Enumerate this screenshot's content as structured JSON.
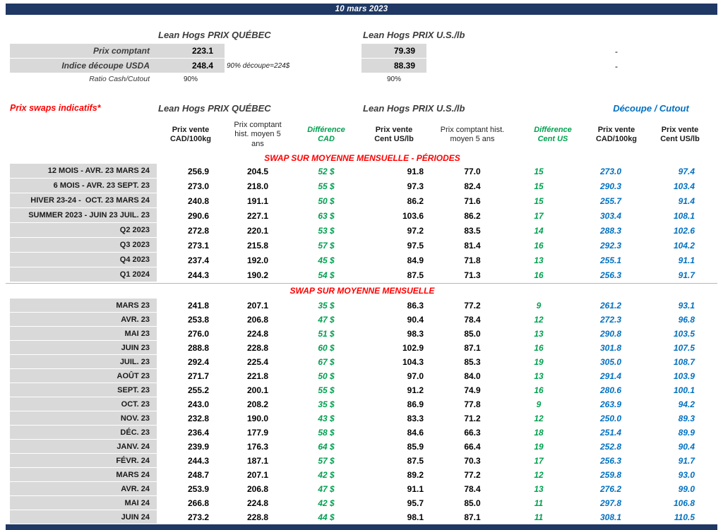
{
  "page": {
    "date": "10 mars 2023"
  },
  "colors": {
    "navy": "#1F3864",
    "red": "#FF0000",
    "green": "#00A050",
    "blue": "#0070C0",
    "gray": "#D9D9D9"
  },
  "spot": {
    "qc_header": "Lean Hogs PRIX QUÉBEC",
    "us_header": "Lean Hogs PRIX U.S./lb",
    "rows": [
      {
        "label": "Prix comptant",
        "qc": "223.1",
        "note": "",
        "us": "79.39",
        "right": "-"
      },
      {
        "label": "Indice découpe USDA",
        "qc": "248.4",
        "note": "90% découpe=224$",
        "us": "88.39",
        "right": "-"
      }
    ],
    "ratio": {
      "label": "Ratio Cash/Cutout",
      "qc": "90%",
      "us": "90%"
    }
  },
  "swaps": {
    "title": "Prix swaps indicatifs*",
    "qc_header": "Lean Hogs PRIX QUÉBEC",
    "us_header": "Lean Hogs PRIX U.S./lb",
    "cutout_header": "Découpe / Cutout",
    "col_headers": [
      "Prix vente\nCAD/100kg",
      "Prix comptant\nhist. moyen 5\nans",
      "Différence\nCAD",
      "Prix vente\nCent US/lb",
      "Prix comptant hist.\nmoyen 5 ans",
      "Différence\nCent US",
      "Prix vente\nCAD/100kg",
      "Prix vente\nCent US/lb"
    ],
    "periods": {
      "title": "SWAP SUR MOYENNE MENSUELLE - PÉRIODES",
      "rows": [
        {
          "label": "12 MOIS - AVR. 23 MARS 24",
          "values": [
            "256.9",
            "204.5",
            "52 $",
            "91.8",
            "77.0",
            "15",
            "273.0",
            "97.4"
          ]
        },
        {
          "label": "6 MOIS - AVR. 23 SEPT. 23",
          "values": [
            "273.0",
            "218.0",
            "55 $",
            "97.3",
            "82.4",
            "15",
            "290.3",
            "103.4"
          ]
        },
        {
          "label": "HIVER 23-24 -  OCT. 23 MARS 24",
          "values": [
            "240.8",
            "191.1",
            "50 $",
            "86.2",
            "71.6",
            "15",
            "255.7",
            "91.4"
          ]
        },
        {
          "label": "SUMMER 2023 - JUIN 23 JUIL. 23",
          "values": [
            "290.6",
            "227.1",
            "63 $",
            "103.6",
            "86.2",
            "17",
            "303.4",
            "108.1"
          ]
        },
        {
          "label": "Q2 2023",
          "values": [
            "272.8",
            "220.1",
            "53 $",
            "97.2",
            "83.5",
            "14",
            "288.3",
            "102.6"
          ]
        },
        {
          "label": "Q3 2023",
          "values": [
            "273.1",
            "215.8",
            "57 $",
            "97.5",
            "81.4",
            "16",
            "292.3",
            "104.2"
          ]
        },
        {
          "label": "Q4 2023",
          "values": [
            "237.4",
            "192.0",
            "45 $",
            "84.9",
            "71.8",
            "13",
            "255.1",
            "91.1"
          ]
        },
        {
          "label": "Q1 2024",
          "values": [
            "244.3",
            "190.2",
            "54 $",
            "87.5",
            "71.3",
            "16",
            "256.3",
            "91.7"
          ]
        }
      ]
    },
    "months": {
      "title": "SWAP SUR MOYENNE MENSUELLE",
      "rows": [
        {
          "label": "MARS 23",
          "values": [
            "241.8",
            "207.1",
            "35 $",
            "86.3",
            "77.2",
            "9",
            "261.2",
            "93.1"
          ]
        },
        {
          "label": "AVR. 23",
          "values": [
            "253.8",
            "206.8",
            "47 $",
            "90.4",
            "78.4",
            "12",
            "272.3",
            "96.8"
          ]
        },
        {
          "label": "MAI 23",
          "values": [
            "276.0",
            "224.8",
            "51 $",
            "98.3",
            "85.0",
            "13",
            "290.8",
            "103.5"
          ]
        },
        {
          "label": "JUIN 23",
          "values": [
            "288.8",
            "228.8",
            "60 $",
            "102.9",
            "87.1",
            "16",
            "301.8",
            "107.5"
          ]
        },
        {
          "label": "JUIL. 23",
          "values": [
            "292.4",
            "225.4",
            "67 $",
            "104.3",
            "85.3",
            "19",
            "305.0",
            "108.7"
          ]
        },
        {
          "label": "AOÛT 23",
          "values": [
            "271.7",
            "221.8",
            "50 $",
            "97.0",
            "84.0",
            "13",
            "291.4",
            "103.9"
          ]
        },
        {
          "label": "SEPT. 23",
          "values": [
            "255.2",
            "200.1",
            "55 $",
            "91.2",
            "74.9",
            "16",
            "280.6",
            "100.1"
          ]
        },
        {
          "label": "OCT. 23",
          "values": [
            "243.0",
            "208.2",
            "35 $",
            "86.9",
            "77.8",
            "9",
            "263.9",
            "94.2"
          ]
        },
        {
          "label": "NOV. 23",
          "values": [
            "232.8",
            "190.0",
            "43 $",
            "83.3",
            "71.2",
            "12",
            "250.0",
            "89.3"
          ]
        },
        {
          "label": "DÉC. 23",
          "values": [
            "236.4",
            "177.9",
            "58 $",
            "84.6",
            "66.3",
            "18",
            "251.4",
            "89.9"
          ]
        },
        {
          "label": "JANV. 24",
          "values": [
            "239.9",
            "176.3",
            "64 $",
            "85.9",
            "66.4",
            "19",
            "252.8",
            "90.4"
          ]
        },
        {
          "label": "FÉVR. 24",
          "values": [
            "244.3",
            "187.1",
            "57 $",
            "87.5",
            "70.3",
            "17",
            "256.3",
            "91.7"
          ]
        },
        {
          "label": "MARS 24",
          "values": [
            "248.7",
            "207.1",
            "42 $",
            "89.2",
            "77.2",
            "12",
            "259.8",
            "93.0"
          ]
        },
        {
          "label": "AVR. 24",
          "values": [
            "253.9",
            "206.8",
            "47 $",
            "91.1",
            "78.4",
            "13",
            "276.2",
            "99.0"
          ]
        },
        {
          "label": "MAI 24",
          "values": [
            "266.8",
            "224.8",
            "42 $",
            "95.7",
            "85.0",
            "11",
            "297.8",
            "106.8"
          ]
        },
        {
          "label": "JUIN 24",
          "values": [
            "273.2",
            "228.8",
            "44 $",
            "98.1",
            "87.1",
            "11",
            "308.1",
            "110.5"
          ]
        }
      ]
    }
  }
}
